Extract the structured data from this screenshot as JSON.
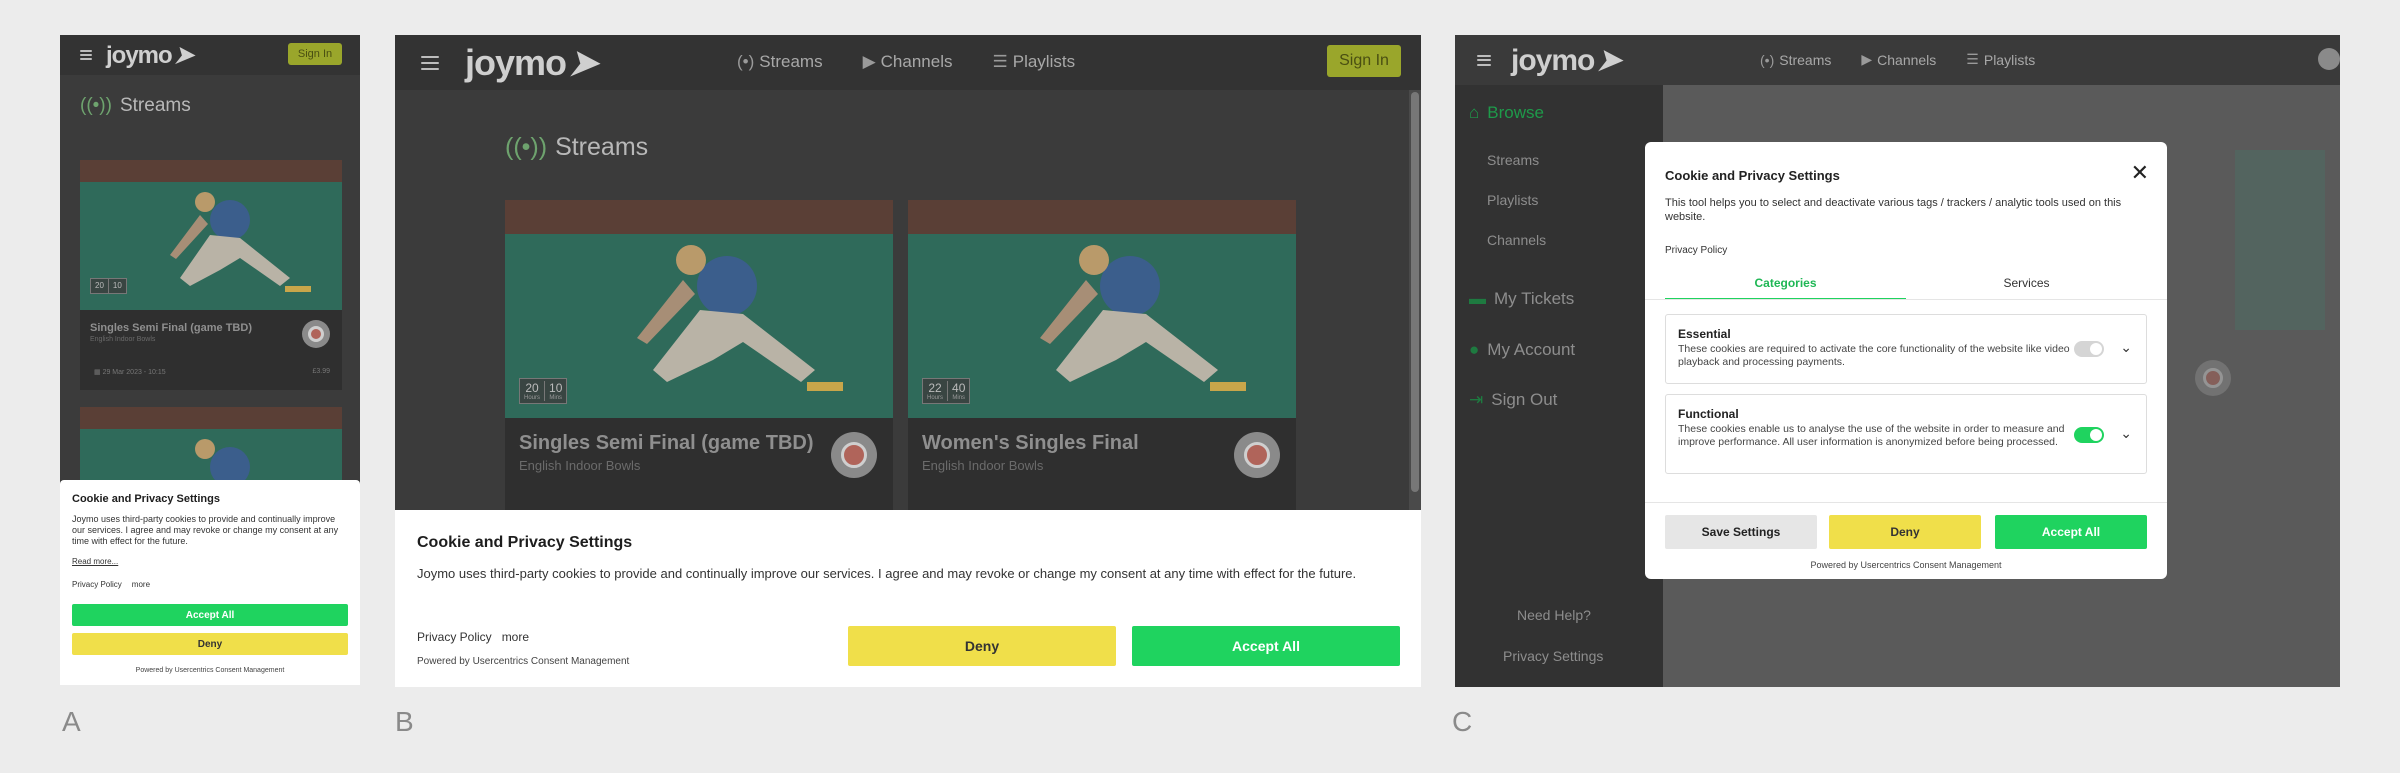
{
  "labels": {
    "a": "A",
    "b": "B",
    "c": "C"
  },
  "app": {
    "logo": "joymo",
    "sign_in": "Sign In",
    "nav": [
      "Streams",
      "Channels",
      "Playlists"
    ],
    "streams_title": "Streams"
  },
  "cards": [
    {
      "title": "Singles Semi Final (game TBD)",
      "subtitle": "English Indoor Bowls",
      "count_a": "20",
      "count_b": "10",
      "unit_a": "Hours",
      "unit_b": "Mins"
    },
    {
      "title": "Women's Singles Final",
      "subtitle": "English Indoor Bowls",
      "count_a": "22",
      "count_b": "40",
      "unit_a": "Hours",
      "unit_b": "Mins"
    }
  ],
  "mobile": {
    "card_date": "29 Mar 2023 - 10:15",
    "card_price": "£3.99"
  },
  "banner": {
    "title": "Cookie and Privacy Settings",
    "text": "Joymo uses third-party cookies to provide and continually improve our services. I agree and may revoke or change my consent at any time with effect for the future.",
    "read_more": "Read more...",
    "privacy_policy": "Privacy Policy",
    "more": "more",
    "accept": "Accept All",
    "deny": "Deny",
    "powered": "Powered by Usercentrics Consent Management"
  },
  "sidebar": {
    "browse": "Browse",
    "streams": "Streams",
    "playlists": "Playlists",
    "channels": "Channels",
    "tickets": "My Tickets",
    "account": "My Account",
    "signout": "Sign Out",
    "help": "Need Help?",
    "privacy": "Privacy Settings"
  },
  "modal": {
    "title": "Cookie and Privacy Settings",
    "text": "This tool helps you to select and deactivate various tags / trackers / analytic tools used on this website.",
    "privacy_policy": "Privacy Policy",
    "tab_categories": "Categories",
    "tab_services": "Services",
    "essential_title": "Essential",
    "essential_text": "These cookies are required to activate the core functionality of the website like video playback and processing payments.",
    "functional_title": "Functional",
    "functional_text": "These cookies enable us to analyse the use of the website in order to measure and improve performance. All user information is anonymized before being processed.",
    "save": "Save Settings",
    "deny": "Deny",
    "accept": "Accept All",
    "powered": "Powered by Usercentrics Consent Management"
  },
  "colors": {
    "green": "#1fd35f",
    "yellow": "#f0df4a",
    "dark": "#3b3b3b"
  },
  "icons": {
    "menu": "hamburger-icon",
    "close": "close-icon",
    "chevron": "chevron-down-icon"
  }
}
